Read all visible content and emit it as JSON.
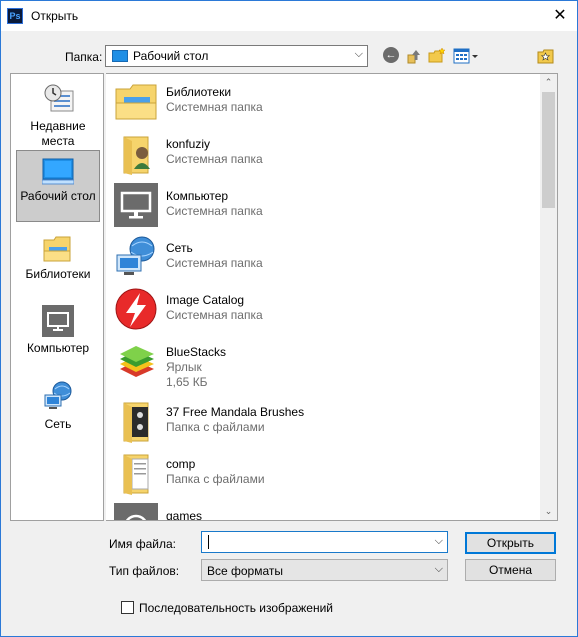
{
  "window": {
    "title": "Открыть",
    "app_icon_text": "Ps"
  },
  "toolbar": {
    "folder_label": "Папка:",
    "folder_value": "Рабочий стол",
    "icons": [
      "back-icon",
      "up-folder-icon",
      "new-folder-icon",
      "view-menu-icon",
      "favorites-icon"
    ]
  },
  "places": [
    {
      "label": "Недавние места",
      "icon": "recent-places-icon"
    },
    {
      "label": "Рабочий стол",
      "icon": "desktop-icon",
      "active": true
    },
    {
      "label": "Библиотеки",
      "icon": "libraries-icon"
    },
    {
      "label": "Компьютер",
      "icon": "computer-icon"
    },
    {
      "label": "Сеть",
      "icon": "network-icon"
    }
  ],
  "files": [
    {
      "name": "Библиотеки",
      "sub": "Системная папка",
      "icon": "libraries-icon"
    },
    {
      "name": "konfuziy",
      "sub": "Системная папка",
      "icon": "user-folder-icon"
    },
    {
      "name": "Компьютер",
      "sub": "Системная папка",
      "icon": "computer-icon"
    },
    {
      "name": "Сеть",
      "sub": "Системная папка",
      "icon": "network-icon"
    },
    {
      "name": "Image Catalog",
      "sub": "Системная папка",
      "icon": "image-catalog-icon"
    },
    {
      "name": "BlueStacks",
      "sub": "Ярлык",
      "sub2": "1,65 КБ",
      "icon": "bluestacks-icon"
    },
    {
      "name": "37 Free Mandala Brushes",
      "sub": "Папка с файлами",
      "icon": "folder-icon"
    },
    {
      "name": "comp",
      "sub": "Папка с файлами",
      "icon": "folder-icon"
    },
    {
      "name": "games",
      "sub": "",
      "icon": "games-icon"
    }
  ],
  "form": {
    "filename_label": "Имя файла:",
    "filename_value": "",
    "filetype_label": "Тип файлов:",
    "filetype_value": "Все форматы",
    "open_label": "Открыть",
    "cancel_label": "Отмена",
    "sequence_label": "Последовательность изображений",
    "sequence_checked": false
  },
  "colors": {
    "accent": "#0078d7",
    "selection": "#cccccc",
    "titlebar_border": "#2b79d7"
  }
}
